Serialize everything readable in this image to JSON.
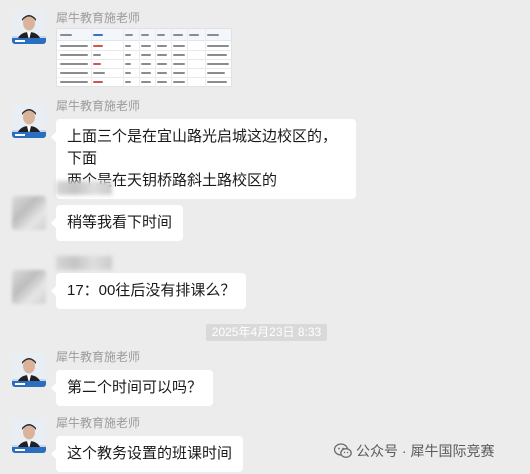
{
  "chat": {
    "sender_name": "犀牛教育施老师",
    "timestamp": "2025年4月23日 8:33",
    "messages": [
      {
        "type": "image",
        "from": "teacher",
        "description_icon": "spreadsheet-thumbnail"
      },
      {
        "type": "text",
        "from": "teacher",
        "lines": [
          "上面三个是在宜山路光启城这边校区的，下面",
          "两个是在天钥桥路斜土路校区的"
        ]
      },
      {
        "type": "text",
        "from": "parent",
        "lines": [
          "稍等我看下时间"
        ]
      },
      {
        "type": "text",
        "from": "parent",
        "lines": [
          "17：00往后没有排课么？"
        ]
      },
      {
        "type": "text",
        "from": "teacher",
        "lines": [
          "第二个时间可以吗？"
        ]
      },
      {
        "type": "text",
        "from": "teacher",
        "lines": [
          "这个教务设置的班课时间"
        ]
      }
    ]
  },
  "watermark": {
    "label": "公众号 · 犀牛国际竞赛",
    "icon": "wechat-icon"
  },
  "colors": {
    "background": "#ececec",
    "bubble": "#ffffff",
    "timestamp_bg": "#d9d9d9",
    "name_gray": "#9b9b9b"
  }
}
